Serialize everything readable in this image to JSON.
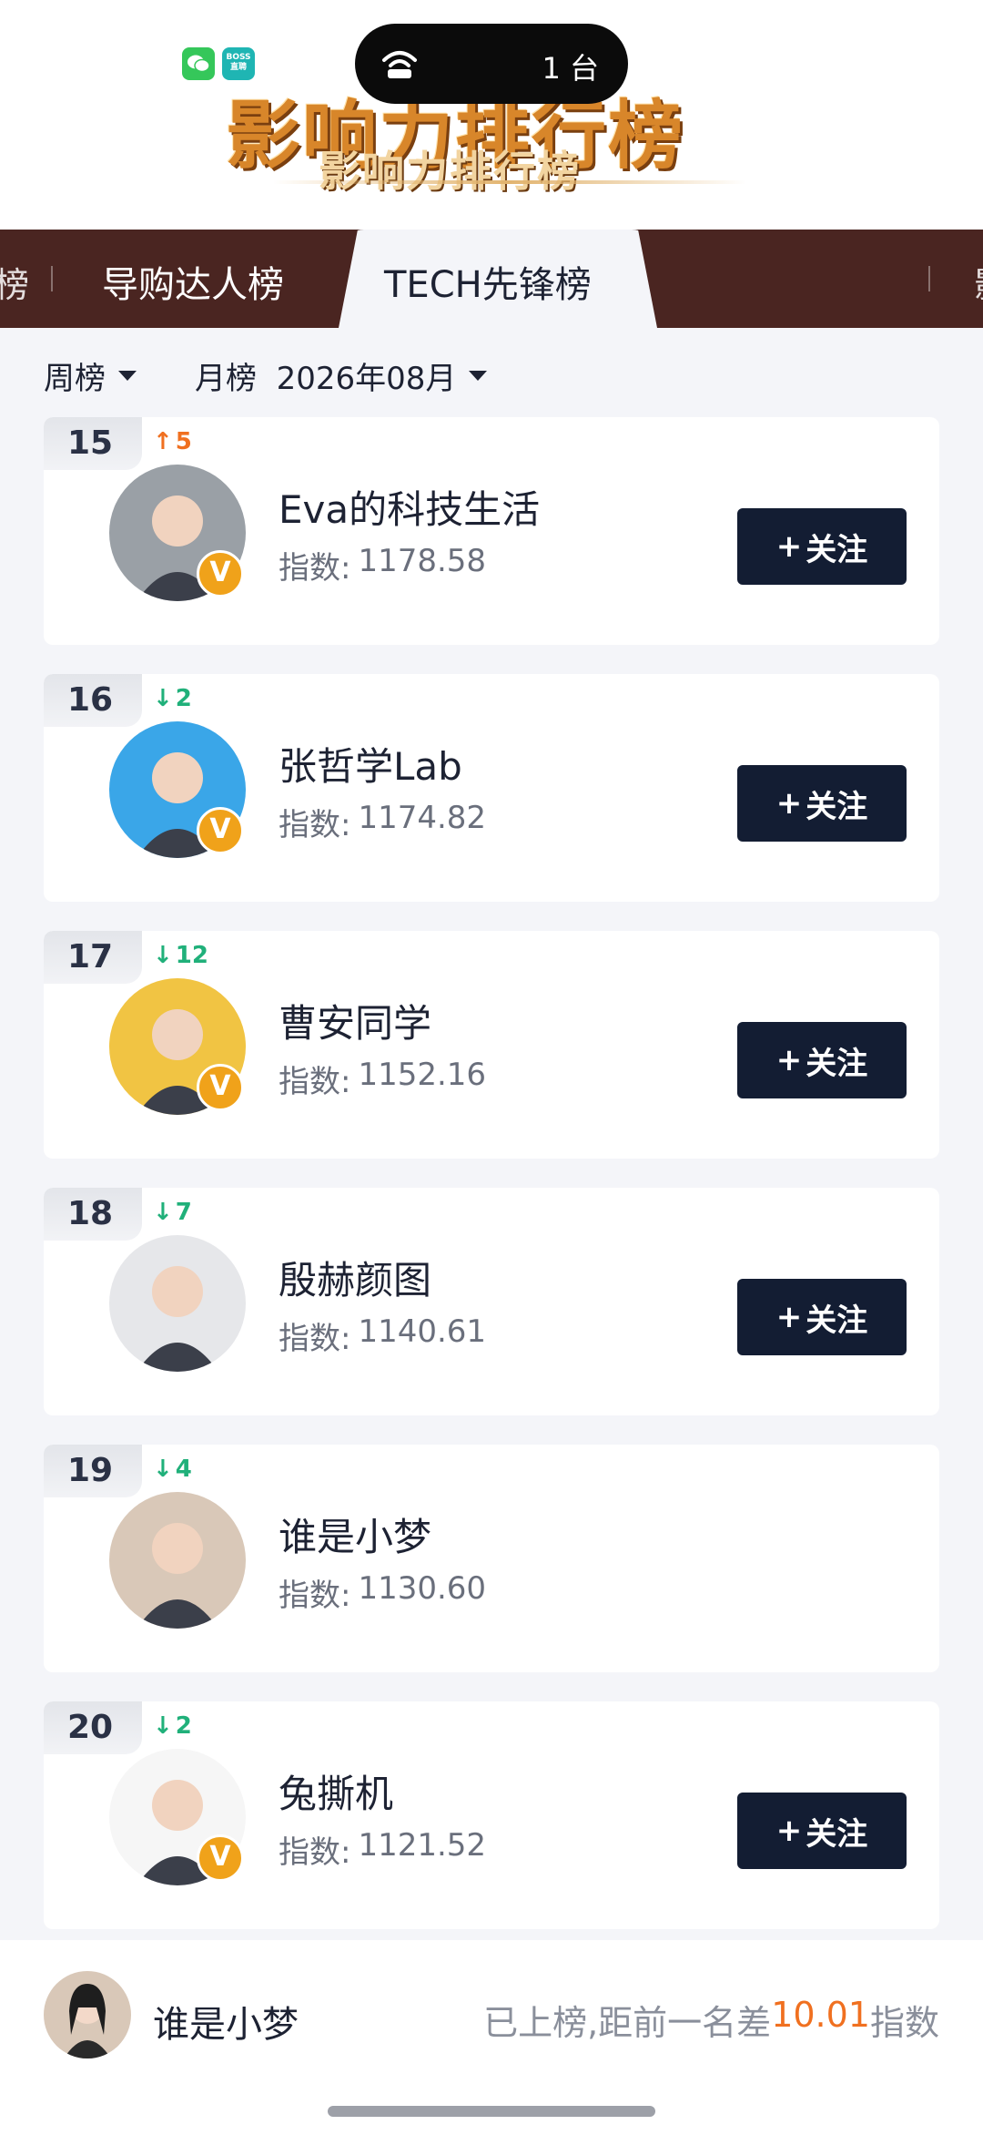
{
  "header": {
    "boss_badge_text": "BOSS\n直聘",
    "island_text": "1 台",
    "banner_title": "影响力排行榜",
    "banner_subtitle": "影响力排行榜"
  },
  "tabs": [
    {
      "label": "导购达人榜"
    },
    {
      "label": "TECH先锋榜",
      "active": true
    }
  ],
  "filters": {
    "weekly": "周榜",
    "monthly": "月榜  2026年08月"
  },
  "list": [
    {
      "rank": "15",
      "trend": "up",
      "trend_value": "5",
      "name": "Eva的科技生活",
      "score_label": "指数:",
      "score": "1178.58",
      "verified": true,
      "follow_label": "关注",
      "avatar_color": "#9aa0a6"
    },
    {
      "rank": "16",
      "trend": "down",
      "trend_value": "2",
      "name": "张哲学Lab",
      "score_label": "指数:",
      "score": "1174.82",
      "verified": true,
      "follow_label": "关注",
      "avatar_color": "#3aa6e8"
    },
    {
      "rank": "17",
      "trend": "down",
      "trend_value": "12",
      "name": "曹安同学",
      "score_label": "指数:",
      "score": "1152.16",
      "verified": true,
      "follow_label": "关注",
      "avatar_color": "#f1c443"
    },
    {
      "rank": "18",
      "trend": "down",
      "trend_value": "7",
      "name": "殷赫颜图",
      "score_label": "指数:",
      "score": "1140.61",
      "verified": false,
      "follow_label": "关注",
      "avatar_color": "#e6e7ea"
    },
    {
      "rank": "19",
      "trend": "down",
      "trend_value": "4",
      "name": "谁是小梦",
      "score_label": "指数:",
      "score": "1130.60",
      "verified": false,
      "follow_label": "",
      "avatar_color": "#d9c8b8"
    },
    {
      "rank": "20",
      "trend": "down",
      "trend_value": "2",
      "name": "兔撕机",
      "score_label": "指数:",
      "score": "1121.52",
      "verified": true,
      "follow_label": "关注",
      "avatar_color": "#f6f6f6"
    }
  ],
  "me": {
    "name": "谁是小梦",
    "status_prefix": "已上榜,距前一名差",
    "status_value": "10.01",
    "status_suffix": "指数"
  },
  "colors": {
    "tabbar": "#4a2521",
    "follow_button": "#131d33",
    "trend_up": "#f07020",
    "trend_down": "#20b07a",
    "verified_badge": "#f0a21a"
  }
}
